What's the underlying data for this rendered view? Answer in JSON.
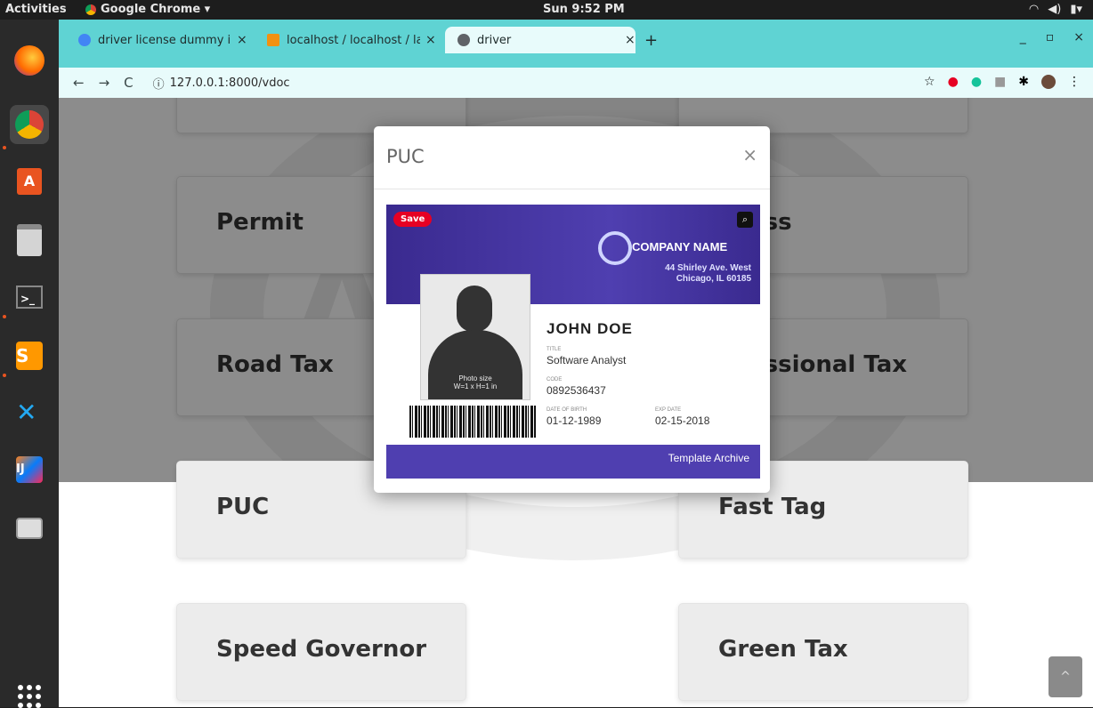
{
  "topbar": {
    "activities": "Activities",
    "app": "Google Chrome ▾",
    "clock": "Sun  9:52 PM"
  },
  "tabs": [
    {
      "label": "driver license dummy ima",
      "color": "#4285f4"
    },
    {
      "label": "localhost / localhost / lar",
      "color": "#f29111"
    },
    {
      "label": "driver",
      "color": "#5f6368"
    }
  ],
  "browser": {
    "url": "127.0.0.1:8000/vdoc"
  },
  "cards": [
    "Permit",
    "ess",
    "Road Tax",
    "essional Tax",
    "PUC",
    "Fast Tag",
    "Speed Governor",
    "Green Tax"
  ],
  "modal": {
    "title": "PUC",
    "close": "×",
    "image": {
      "save": "Save",
      "company": "COMPANY NAME",
      "address_line1": "44 Shirley Ave. West",
      "address_line2": "Chicago, IL 60185",
      "name": "JOHN DOE",
      "title_label": "TITLE",
      "title_value": "Software Analyst",
      "code_label": "CODE",
      "code_value": "0892536437",
      "dob_label": "DATE OF BIRTH",
      "dob_value": "01-12-1989",
      "exp_label": "EXP DATE",
      "exp_value": "02-15-2018",
      "photo_size": "Photo size",
      "photo_dims": "W=1 x H=1 in",
      "footer": "Template Archive"
    }
  }
}
